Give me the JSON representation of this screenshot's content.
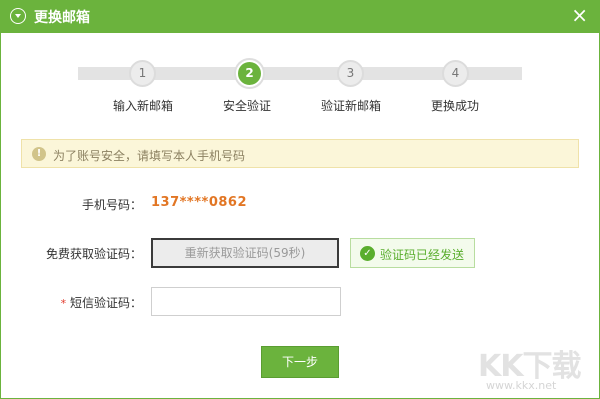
{
  "window": {
    "title": "更换邮箱",
    "close": "×"
  },
  "steps": [
    {
      "num": "1",
      "label": "输入新邮箱",
      "active": false
    },
    {
      "num": "2",
      "label": "安全验证",
      "active": true
    },
    {
      "num": "3",
      "label": "验证新邮箱",
      "active": false
    },
    {
      "num": "4",
      "label": "更换成功",
      "active": false
    }
  ],
  "tip": {
    "icon": "!",
    "text": "为了账号安全，请填写本人手机号码"
  },
  "form": {
    "phone_label": "手机号码：",
    "phone_value": "137****0862",
    "code_label": "免费获取验证码：",
    "resend_label": "重新获取验证码(59秒)",
    "sent_icon": "✓",
    "sent_status": "验证码已经发送",
    "sms_required": "*",
    "sms_label": " 短信验证码：",
    "sms_value": ""
  },
  "next_label": "下一步",
  "watermark": {
    "logo": "KK下载",
    "url": "www.kkx.net"
  },
  "colors": {
    "accent": "#6bb33d",
    "phone": "#e27624",
    "tip_bg": "#fbf6d9",
    "success": "#5aae2e"
  }
}
